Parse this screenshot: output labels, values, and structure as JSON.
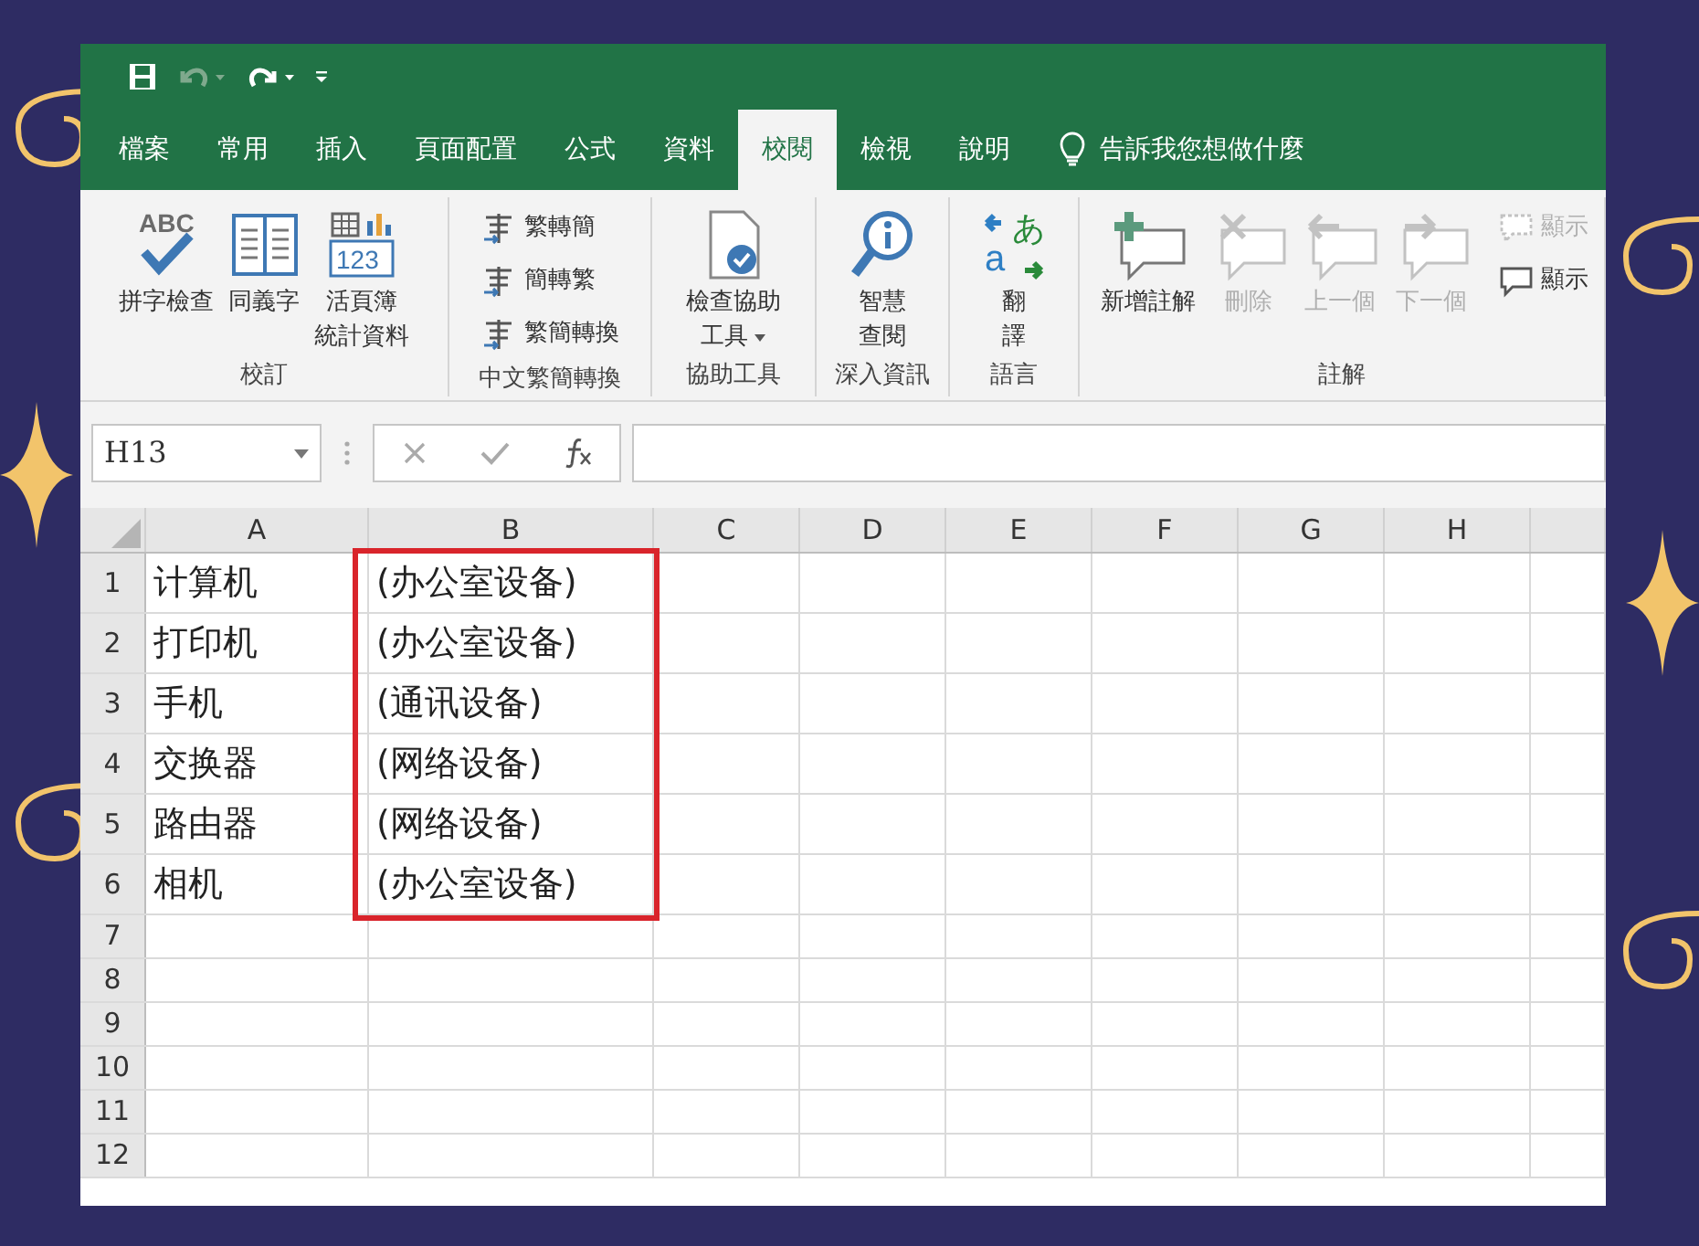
{
  "quick_access": [
    {
      "kind": "save",
      "disabled": false
    },
    {
      "kind": "undo",
      "disabled": true
    },
    {
      "kind": "redo",
      "disabled": false
    },
    {
      "kind": "customize",
      "disabled": false
    }
  ],
  "tabs": [
    {
      "label": "檔案",
      "selected": false
    },
    {
      "label": "常用",
      "selected": false
    },
    {
      "label": "插入",
      "selected": false
    },
    {
      "label": "頁面配置",
      "selected": false
    },
    {
      "label": "公式",
      "selected": false
    },
    {
      "label": "資料",
      "selected": false
    },
    {
      "label": "校閱",
      "selected": true
    },
    {
      "label": "檢視",
      "selected": false
    },
    {
      "label": "說明",
      "selected": false
    }
  ],
  "tell_me": {
    "placeholder": "告訴我您想做什麼"
  },
  "ribbon_groups": [
    {
      "label": "校訂",
      "items": [
        {
          "kind": "large",
          "lines": [
            "拼字檢查"
          ],
          "icon_text": [
            "ABC"
          ],
          "disabled": false
        },
        {
          "kind": "large",
          "lines": [
            "同義字"
          ],
          "disabled": false
        },
        {
          "kind": "large",
          "lines": [
            "活頁簿",
            "統計資料"
          ],
          "icon_text": [
            "123"
          ],
          "disabled": false
        }
      ]
    },
    {
      "label": "中文繁簡轉換",
      "items": [
        {
          "kind": "small",
          "lines": [
            "繁轉簡"
          ],
          "disabled": false
        },
        {
          "kind": "small",
          "lines": [
            "簡轉繁"
          ],
          "disabled": false
        },
        {
          "kind": "small",
          "lines": [
            "繁簡轉換"
          ],
          "disabled": false
        }
      ]
    },
    {
      "label": "協助工具",
      "items": [
        {
          "kind": "large",
          "lines": [
            "檢查協助",
            "工具"
          ],
          "dropdown": true,
          "disabled": false
        }
      ]
    },
    {
      "label": "深入資訊",
      "items": [
        {
          "kind": "large",
          "lines": [
            "智慧",
            "查閱"
          ],
          "disabled": false
        }
      ]
    },
    {
      "label": "語言",
      "items": [
        {
          "kind": "large",
          "lines": [
            "翻",
            "譯"
          ],
          "icon_text": [
            "あ",
            "a"
          ],
          "disabled": false
        }
      ]
    },
    {
      "label": "註解",
      "items": [
        {
          "kind": "large",
          "lines": [
            "新增註解"
          ],
          "disabled": false
        },
        {
          "kind": "large",
          "lines": [
            "刪除"
          ],
          "disabled": true
        },
        {
          "kind": "large",
          "lines": [
            "上一個"
          ],
          "disabled": true
        },
        {
          "kind": "large",
          "lines": [
            "下一個"
          ],
          "disabled": true
        },
        {
          "kind": "small",
          "lines": [
            "顯示"
          ],
          "disabled": true
        },
        {
          "kind": "small",
          "lines": [
            "顯示"
          ],
          "disabled": false
        }
      ]
    }
  ],
  "name_box": {
    "value": "H13"
  },
  "formula_buttons": [
    {
      "kind": "cancel"
    },
    {
      "kind": "enter"
    },
    {
      "kind": "function"
    }
  ],
  "columns": [
    "A",
    "B",
    "C",
    "D",
    "E",
    "F",
    "G",
    "H",
    ""
  ],
  "rows": [
    {
      "header": "1",
      "cells": [
        "计算机",
        "(办公室设备)"
      ],
      "highlighted": true
    },
    {
      "header": "2",
      "cells": [
        "打印机",
        "(办公室设备)"
      ],
      "highlighted": true
    },
    {
      "header": "3",
      "cells": [
        "手机",
        "(通讯设备)"
      ],
      "highlighted": true
    },
    {
      "header": "4",
      "cells": [
        "交换器",
        "(网络设备)"
      ],
      "highlighted": true
    },
    {
      "header": "5",
      "cells": [
        "路由器",
        "(网络设备)"
      ],
      "highlighted": true
    },
    {
      "header": "6",
      "cells": [
        "相机",
        "(办公室设备)"
      ],
      "highlighted": true
    },
    {
      "header": "7",
      "cells": [],
      "highlighted": false
    },
    {
      "header": "8",
      "cells": [],
      "highlighted": false
    },
    {
      "header": "9",
      "cells": [],
      "highlighted": false
    },
    {
      "header": "10",
      "cells": [],
      "highlighted": false
    },
    {
      "header": "11",
      "cells": [],
      "highlighted": false
    },
    {
      "header": "12",
      "cells": [],
      "highlighted": false
    }
  ]
}
